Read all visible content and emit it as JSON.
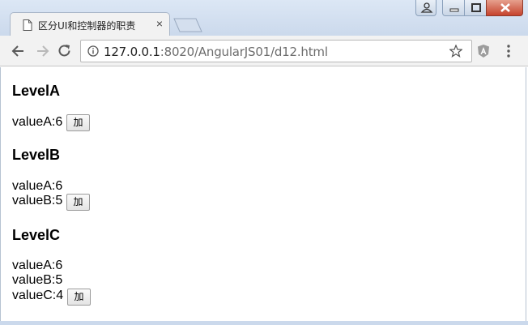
{
  "browser": {
    "tab_title": "区分UI和控制器的职责",
    "tab_close": "×",
    "url_host": "127.0.0.1",
    "url_path": ":8020/AngularJS01/d12.html",
    "icons": {
      "tab": "document-icon",
      "back": "back-arrow-icon",
      "forward": "forward-arrow-icon",
      "reload": "reload-icon",
      "info": "info-icon",
      "bookmark": "star-icon",
      "extension": "angular-extension-icon",
      "menu": "kebab-menu-icon"
    }
  },
  "page": {
    "level_a": {
      "title": "LevelA",
      "value_a": "valueA:6",
      "button": "加"
    },
    "level_b": {
      "title": "LevelB",
      "value_a": "valueA:6",
      "value_b": "valueB:5",
      "button": "加"
    },
    "level_c": {
      "title": "LevelC",
      "value_a": "valueA:6",
      "value_b": "valueB:5",
      "value_c": "valueC:4",
      "button": "加"
    }
  }
}
